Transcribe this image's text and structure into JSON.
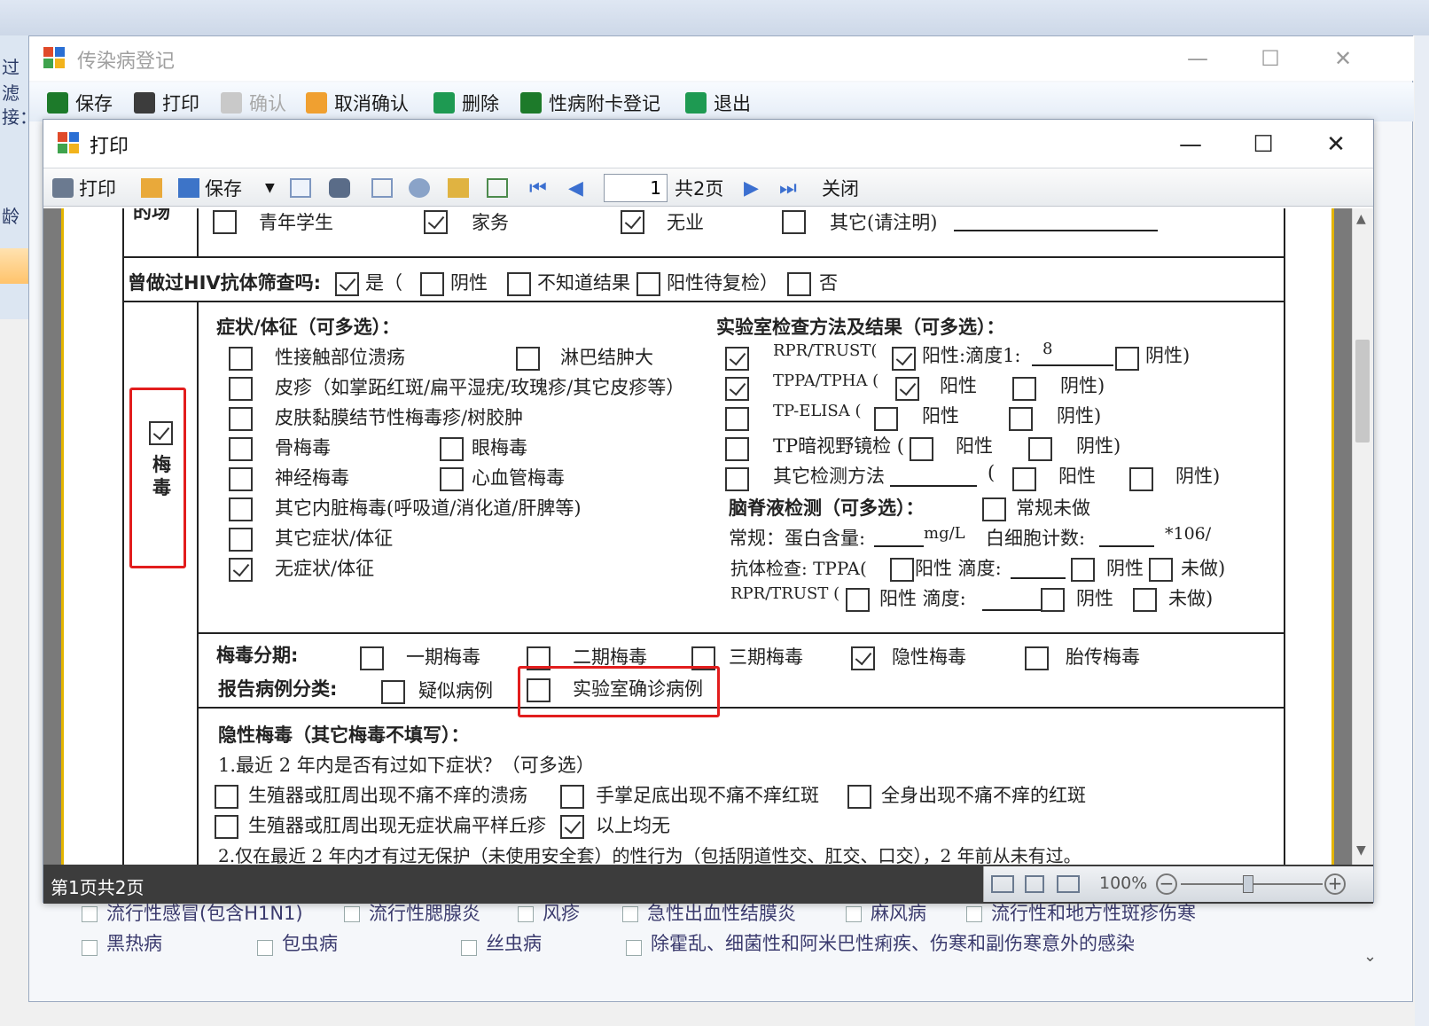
{
  "outer_window": {
    "title": "传染病登记",
    "toolbar": [
      {
        "label": "保存",
        "enabled": true
      },
      {
        "label": "打印",
        "enabled": true
      },
      {
        "label": "确认",
        "enabled": false
      },
      {
        "label": "取消确认",
        "enabled": true
      },
      {
        "label": "删除",
        "enabled": true
      },
      {
        "label": "性病附卡登记",
        "enabled": true
      },
      {
        "label": "退出",
        "enabled": true
      }
    ],
    "side_fragments": [
      "过滤",
      "接：",
      "龄"
    ]
  },
  "print_window": {
    "title": "打印",
    "toolbar": {
      "print_label": "打印",
      "save_label": "保存",
      "page_value": "1",
      "page_total": "共2页",
      "close_label": "关闭"
    },
    "status": "第1页共2页",
    "zoom": "100%"
  },
  "form": {
    "occupation_row": {
      "left_label": "的场",
      "options": [
        {
          "label": "青年学生",
          "checked": false
        },
        {
          "label": "家务",
          "checked": true
        },
        {
          "label": "无业",
          "checked": false
        },
        {
          "label": "其它(请注明)",
          "checked": false
        }
      ]
    },
    "hiv_row": {
      "label": "曾做过HIV抗体筛查吗:",
      "yes": "是（",
      "yes_checked": true,
      "neg": "阴性",
      "unknown": "不知道结果",
      "pending": "阳性待复检）",
      "no": "否"
    },
    "syphilis": {
      "label": "梅毒",
      "checked": true,
      "symptoms_title": "症状/体征（可多选）：",
      "symptoms": [
        {
          "label": "性接触部位溃疡",
          "checked": false
        },
        {
          "label": "淋巴结肿大",
          "checked": false
        },
        {
          "label": "皮疹（如掌跖红斑/扁平湿疣/玫瑰疹/其它皮疹等）",
          "checked": false
        },
        {
          "label": "皮肤黏膜结节性梅毒疹/树胶肿",
          "checked": false
        },
        {
          "label": "骨梅毒",
          "checked": false
        },
        {
          "label": "眼梅毒",
          "checked": false
        },
        {
          "label": "神经梅毒",
          "checked": false
        },
        {
          "label": "心血管梅毒",
          "checked": false
        },
        {
          "label": "其它内脏梅毒(呼吸道/消化道/肝脾等)",
          "checked": false
        },
        {
          "label": "其它症状/体征",
          "checked": false
        },
        {
          "label": "无症状/体征",
          "checked": true
        }
      ],
      "lab_title": "实验室检查方法及结果（可多选）：",
      "lab": {
        "rpr": "RPR/TRUST(",
        "rpr_pos": "阳性:滴度1:",
        "rpr_titer": "8",
        "rpr_neg": "阴性)",
        "tppa": "TPPA/TPHA (",
        "tppa_pos": "阳性",
        "tppa_neg": "阴性)",
        "elisa": "TP-ELISA (",
        "elisa_pos": "阳性",
        "elisa_neg": "阴性)",
        "dark": "TP暗视野镜检 (",
        "dark_pos": "阳性",
        "dark_neg": "阴性)",
        "other": "其它检测方法",
        "other_paren": "(",
        "other_pos": "阳性",
        "other_neg": "阴性)",
        "csf_title": "脑脊液检测（可多选）：",
        "csf_routine_na": "常规未做",
        "routine": "常规：蛋白含量:",
        "unit_mgl": "mg/L",
        "wbc": "白细胞计数:",
        "wbc_unit": "*106/",
        "antibody": "抗体检查: TPPA(",
        "ab_pos": "阳性 滴度:",
        "ab_neg": "阴性",
        "ab_na": "未做)",
        "rpr2": "RPR/TRUST (",
        "rpr2_pos": "阳性 滴度:",
        "rpr2_neg": "阴性",
        "rpr2_na": "未做)"
      },
      "lab_checks": [
        true,
        true,
        false,
        false,
        false
      ]
    },
    "stage": {
      "label": "梅毒分期:",
      "options": [
        {
          "label": "一期梅毒",
          "checked": false
        },
        {
          "label": "二期梅毒",
          "checked": false
        },
        {
          "label": "三期梅毒",
          "checked": false
        },
        {
          "label": "隐性梅毒",
          "checked": true
        },
        {
          "label": "胎传梅毒",
          "checked": false
        }
      ]
    },
    "report": {
      "label": "报告病例分类:",
      "suspected": "疑似病例",
      "confirmed": "实验室确诊病例"
    },
    "latent": {
      "title": "隐性梅毒（其它梅毒不填写）：",
      "q1": "1.最近 2 年内是否有过如下症状？（可多选）",
      "opts": [
        {
          "label": "生殖器或肛周出现不痛不痒的溃疡",
          "checked": false
        },
        {
          "label": "手掌足底出现不痛不痒红斑",
          "checked": false
        },
        {
          "label": "全身出现不痛不痒的红斑",
          "checked": false
        },
        {
          "label": "生殖器或肛周出现无症状扁平样丘疹",
          "checked": false
        },
        {
          "label": "以上均无",
          "checked": true
        }
      ],
      "q2": "2.仅在最近 2 年内才有过无保护（未使用安全套）的性行为（包括阴道性交、肛交、口交），2 年前从未有过。"
    }
  },
  "bottom_form": {
    "row1": [
      "流行性感冒(包含H1N1)",
      "流行性腮腺炎",
      "风疹",
      "急性出血性结膜炎",
      "麻风病",
      "流行性和地方性斑疹伤寒"
    ],
    "row2": [
      "黑热病",
      "包虫病",
      "丝虫病",
      "除霍乱、细菌性和阿米巴性痢疾、伤寒和副伤寒意外的感染"
    ]
  },
  "colors": {
    "highlight": "#e21d1d",
    "page_border": "#e3b400"
  }
}
